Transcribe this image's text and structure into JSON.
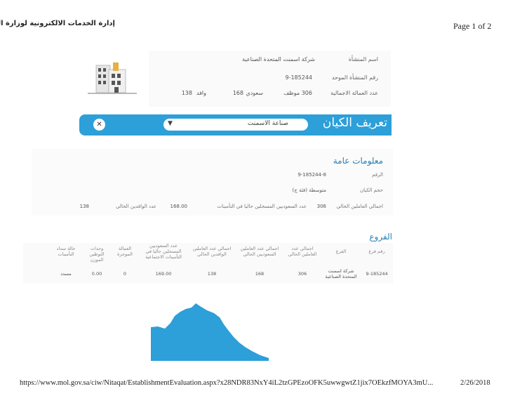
{
  "header": {
    "title": "إدارة الخدمات الالكترونية لوزارة العمل",
    "page_number": "Page 1 of 2"
  },
  "establishment_card": {
    "name_label": "اسم المنشأة",
    "name_value": "شركة اسمنت المتحدة الصناعية",
    "unified_no_label": "رقم المنشأة الموحد",
    "unified_no_value": "9-185244",
    "total_workers_label": "عدد العمالة الاجمالية",
    "total_workers_value": "306 موظف",
    "saudi_label": "سعودي",
    "saudi_value": "168",
    "expat_label": "وافد",
    "expat_value": "138"
  },
  "entity_banner": {
    "title": "تعريف الكيان",
    "select_value": "صناعة الاسمنت",
    "select_icon": "chevron-down-icon",
    "clear_icon": "close-icon",
    "color": "#2d9fd9"
  },
  "general_info": {
    "title": "معلومات عامة",
    "number_label": "الرقم",
    "number_value": "9-185244-8",
    "size_label": "حجم الكيان",
    "size_value": "متوسطة (فئة ج)",
    "total_workers_label": "اجمالي العاملين الحالي",
    "total_workers_value": "306",
    "saudi_label": "عدد السعوديين المسجلين حاليا في التأمينات",
    "saudi_value": "168.00",
    "expat_label": "عدد الوافدين الحالي",
    "expat_value": "138"
  },
  "branches": {
    "title": "الفروع",
    "columns": [
      "رقم فرع",
      "الفرع",
      "اجمالي عدد العاملين الحالي",
      "اجمالي عدد العاملين السعوديين الحالي",
      "اجمالي عدد العاملين الوافدين الحالي",
      "عدد السعوديين المسجلين حاليا في التأمينات الاجتماعية",
      "العمالة الموجرة",
      "وحدات التوطين الموزن",
      "حالة سداد التأمينات"
    ],
    "rows": [
      [
        "9-185244",
        "شركة اسمنت المتحدة الصناعية",
        "306",
        "168",
        "138",
        "169.00",
        "0",
        "0.00",
        "مسدد"
      ]
    ]
  },
  "footer": {
    "url": "https://www.mol.gov.sa/ciw/Nitaqat/EstablishmentEvaluation.aspx?x28NDR83NxY4iL2tzGPEzoOFK5uwwgwtZ1jix7OEkzfMOYA3mU...",
    "date": "2/26/2018"
  },
  "map_color": "#2d9fd9"
}
